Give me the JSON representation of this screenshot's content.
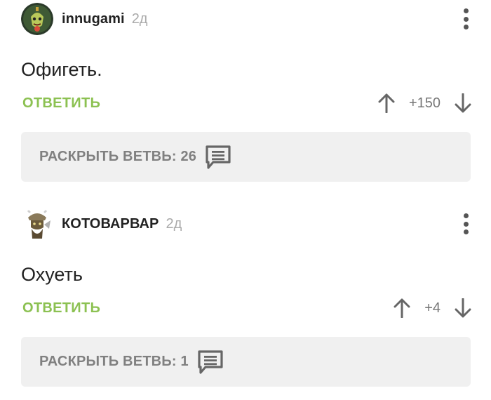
{
  "colors": {
    "accent_green": "#8cc152",
    "username": "#222222",
    "muted": "#aaaaaa",
    "expand_bg": "#f0f0f0",
    "icon_gray": "#666666"
  },
  "comments": [
    {
      "username": "innugami",
      "time": "2д",
      "avatar_icon": "goblin-avatar",
      "text": "Офигеть.",
      "reply_label": "ОТВЕТИТЬ",
      "score": "+150",
      "expand_label": "РАСКРЫТЬ ВЕТВЬ: 26",
      "expand_icon": "comment-bubble-icon"
    },
    {
      "username": "КОТОВАРВАР",
      "time": "2д",
      "avatar_icon": "viking-cat-avatar",
      "text": "Охуеть",
      "reply_label": "ОТВЕТИТЬ",
      "score": "+4",
      "expand_label": "РАСКРЫТЬ ВЕТВЬ: 1",
      "expand_icon": "comment-bubble-icon"
    }
  ]
}
